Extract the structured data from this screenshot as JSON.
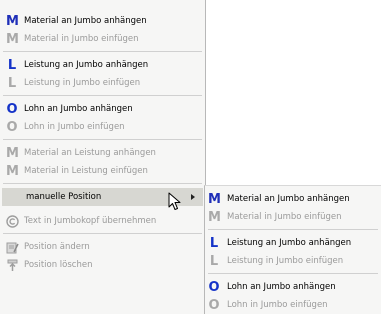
{
  "main_menu": {
    "items": [
      {
        "label": "Material an Jumbo anhängen",
        "icon": "M",
        "enabled": true
      },
      {
        "label": "Material in Jumbo einfügen",
        "icon": "M",
        "enabled": false
      },
      {
        "label": "Leistung an Jumbo anhängen",
        "icon": "L",
        "enabled": true
      },
      {
        "label": "Leistung in Jumbo einfügen",
        "icon": "L",
        "enabled": false
      },
      {
        "label": "Lohn an Jumbo anhängen",
        "icon": "O",
        "enabled": true
      },
      {
        "label": "Lohn in Jumbo einfügen",
        "icon": "O",
        "enabled": false
      },
      {
        "label": "Material an Leistung anhängen",
        "icon": "M",
        "enabled": false
      },
      {
        "label": "Material in Leistung einfügen",
        "icon": "M",
        "enabled": false
      },
      {
        "label": "manuelle Position",
        "icon": "",
        "enabled": true,
        "highlighted": true
      },
      {
        "label": "Text in Jumbokopf übernehmen",
        "icon": "copyright-icon",
        "enabled": false
      },
      {
        "label": "Position ändern",
        "icon": "edit-icon",
        "enabled": false
      },
      {
        "label": "Position löschen",
        "icon": "delete-icon",
        "enabled": false
      }
    ]
  },
  "sub_menu": {
    "items": [
      {
        "label": "Material an Jumbo anhängen",
        "icon": "M",
        "enabled": true
      },
      {
        "label": "Material in Jumbo einfügen",
        "icon": "M",
        "enabled": false
      },
      {
        "label": "Leistung an Jumbo anhängen",
        "icon": "L",
        "enabled": true
      },
      {
        "label": "Leistung in Jumbo einfügen",
        "icon": "L",
        "enabled": false
      },
      {
        "label": "Lohn an Jumbo anhängen",
        "icon": "O",
        "enabled": true
      },
      {
        "label": "Lohn in Jumbo einfügen",
        "icon": "O",
        "enabled": false
      }
    ]
  }
}
